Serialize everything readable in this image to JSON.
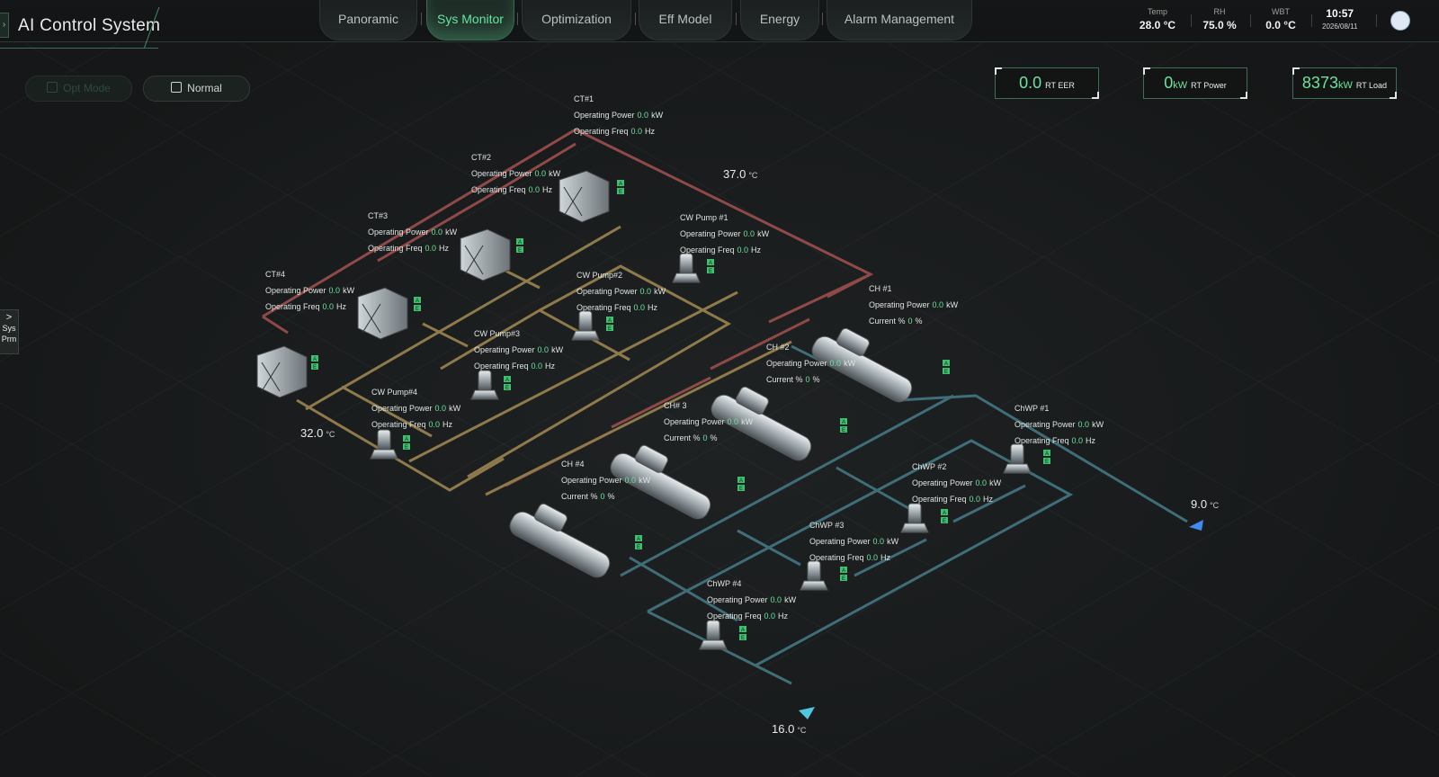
{
  "header": {
    "app_title": "AI Control System",
    "nav": [
      {
        "label": "Panoramic",
        "active": false
      },
      {
        "label": "Sys Monitor",
        "active": true
      },
      {
        "label": "Optimization",
        "active": false
      },
      {
        "label": "Eff Model",
        "active": false
      },
      {
        "label": "Energy",
        "active": false
      },
      {
        "label": "Alarm Management",
        "active": false
      }
    ],
    "env": [
      {
        "label": "Temp",
        "value": "28.0 °C"
      },
      {
        "label": "RH",
        "value": "75.0 %"
      },
      {
        "label": "WBT",
        "value": "0.0 °C"
      }
    ],
    "time": "10:57",
    "date": "2026/08/11"
  },
  "controls": {
    "opt_mode": "Opt Mode",
    "normal": "Normal"
  },
  "kpis": [
    {
      "value": "0.0",
      "unit": "",
      "caption": "RT EER"
    },
    {
      "value": "0",
      "unit": "kW",
      "caption": "RT Power"
    },
    {
      "value": "8373",
      "unit": "kW",
      "caption": "RT Load"
    }
  ],
  "side_tab": {
    "arrow": ">",
    "line1": "Sys",
    "line2": "Prm"
  },
  "labels": {
    "operating_power": "Operating Power",
    "operating_freq": "Operating Freq",
    "current": "Current %",
    "kw": "kW",
    "hz": "Hz",
    "pct": "%"
  },
  "cooling_towers": [
    {
      "name": "CT#1",
      "power": "0.0",
      "freq": "0.0"
    },
    {
      "name": "CT#2",
      "power": "0.0",
      "freq": "0.0"
    },
    {
      "name": "CT#3",
      "power": "0.0",
      "freq": "0.0"
    },
    {
      "name": "CT#4",
      "power": "0.0",
      "freq": "0.0"
    }
  ],
  "cw_pumps": [
    {
      "name": "CW Pump #1",
      "power": "0.0",
      "freq": "0.0"
    },
    {
      "name": "CW Pump#2",
      "power": "0.0",
      "freq": "0.0"
    },
    {
      "name": "CW Pump#3",
      "power": "0.0",
      "freq": "0.0"
    },
    {
      "name": "CW Pump#4",
      "power": "0.0",
      "freq": "0.0"
    }
  ],
  "chillers": [
    {
      "name": "CH #1",
      "power": "0.0",
      "current": "0"
    },
    {
      "name": "CH #2",
      "power": "0.0",
      "current": "0"
    },
    {
      "name": "CH# 3",
      "power": "0.0",
      "current": "0"
    },
    {
      "name": "CH #4",
      "power": "0.0",
      "current": "0"
    }
  ],
  "chw_pumps": [
    {
      "name": "ChWP #1",
      "power": "0.0",
      "freq": "0.0"
    },
    {
      "name": "ChWP #2",
      "power": "0.0",
      "freq": "0.0"
    },
    {
      "name": "ChWP #3",
      "power": "0.0",
      "freq": "0.0"
    },
    {
      "name": "ChWP #4",
      "power": "0.0",
      "freq": "0.0"
    }
  ],
  "temps": {
    "ct_supply": {
      "value": "37.0",
      "unit": "°C"
    },
    "ct_return": {
      "value": "32.0",
      "unit": "°C"
    },
    "chw_supply": {
      "value": "9.0",
      "unit": "°C"
    },
    "chw_return": {
      "value": "16.0",
      "unit": "°C"
    }
  },
  "badges": {
    "a": "A",
    "e": "E"
  },
  "colors": {
    "accent": "#6ee39f",
    "cw_hot": "#8f4a48",
    "cw_cool": "#8e7a4a",
    "chw": "#3f6d78"
  }
}
